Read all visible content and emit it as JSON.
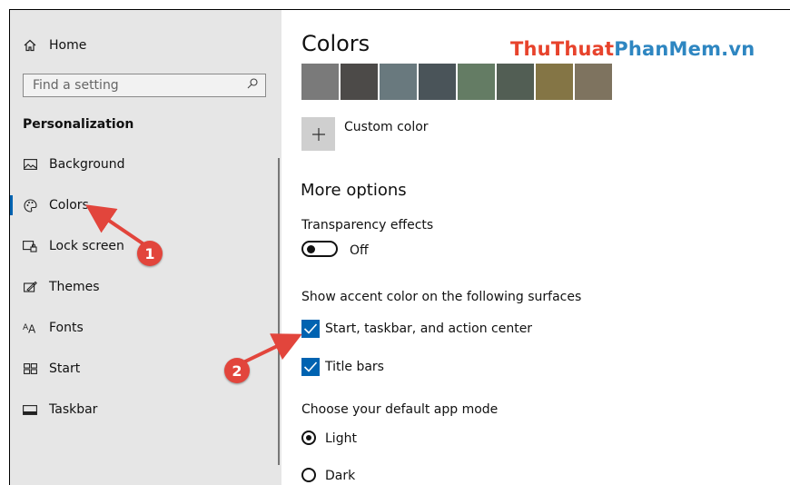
{
  "sidebar": {
    "home_label": "Home",
    "search_placeholder": "Find a setting",
    "section_title": "Personalization",
    "items": [
      {
        "label": "Background",
        "icon": "picture-icon"
      },
      {
        "label": "Colors",
        "icon": "palette-icon",
        "active": true
      },
      {
        "label": "Lock screen",
        "icon": "lock-screen-icon"
      },
      {
        "label": "Themes",
        "icon": "themes-icon"
      },
      {
        "label": "Fonts",
        "icon": "fonts-icon"
      },
      {
        "label": "Start",
        "icon": "start-icon"
      },
      {
        "label": "Taskbar",
        "icon": "taskbar-icon"
      }
    ]
  },
  "main": {
    "title": "Colors",
    "watermark_part1": "ThuThuat",
    "watermark_part2": "PhanMem.vn",
    "swatches": [
      "#7a7a7a",
      "#4c4a48",
      "#69797e",
      "#4a5459",
      "#647c64",
      "#525e54",
      "#847545",
      "#7e735f"
    ],
    "custom_color_label": "Custom color",
    "more_options_heading": "More options",
    "transparency_label": "Transparency effects",
    "transparency_state": "Off",
    "accent_surfaces_label": "Show accent color on the following surfaces",
    "checkbox_start_label": "Start, taskbar, and action center",
    "checkbox_titlebars_label": "Title bars",
    "app_mode_label": "Choose your default app mode",
    "radio_light_label": "Light",
    "radio_dark_label": "Dark"
  },
  "annotations": {
    "badge1": "1",
    "badge2": "2"
  },
  "colors": {
    "accent": "#0063b1",
    "annotation_red": "#e2453c",
    "sidebar_bg": "#e6e6e6"
  }
}
